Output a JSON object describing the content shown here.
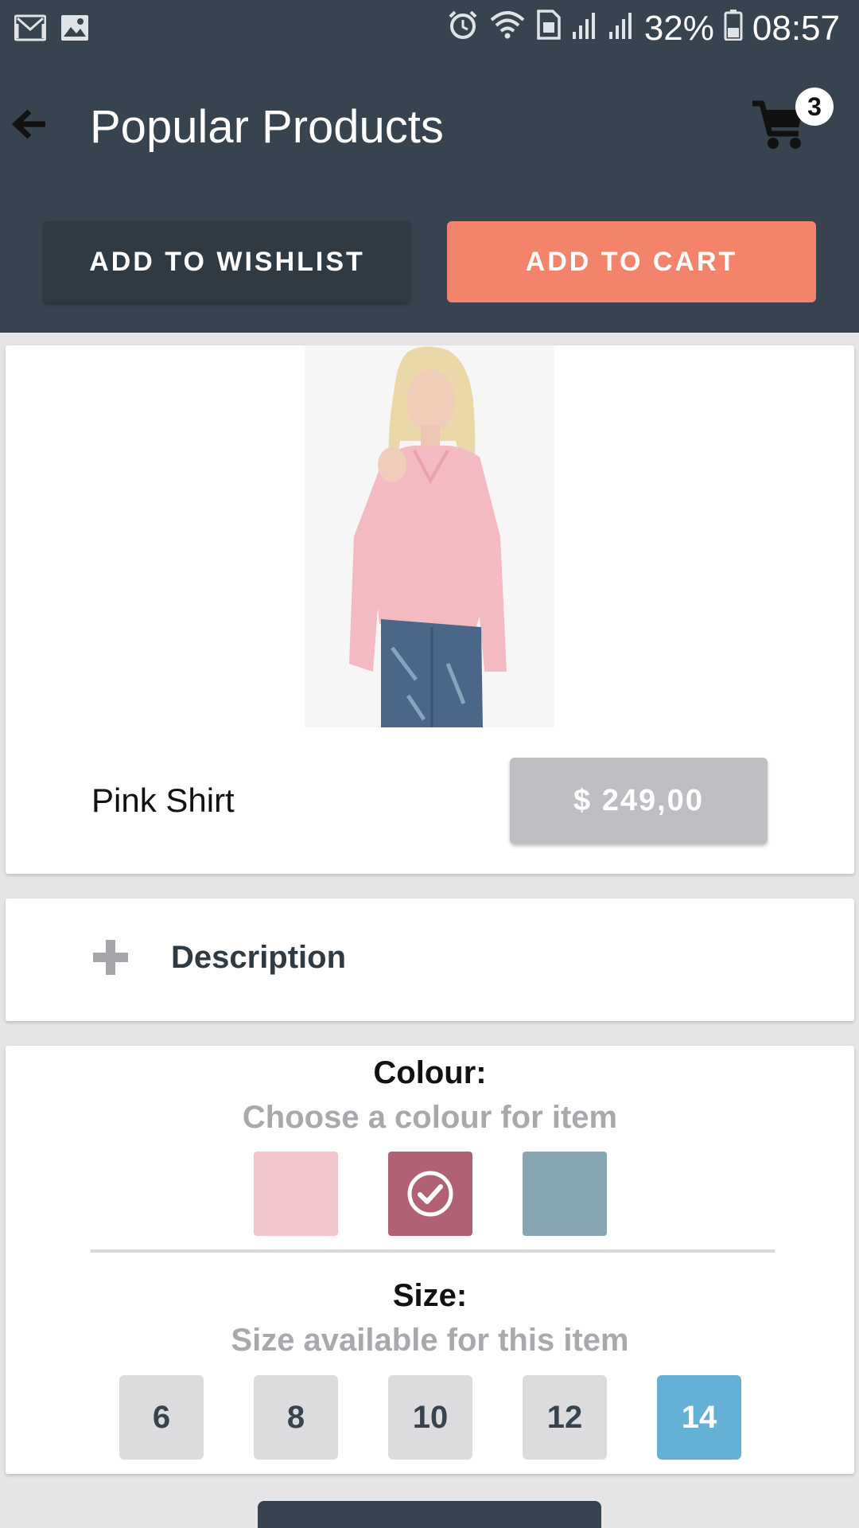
{
  "status_bar": {
    "battery": "32%",
    "time": "08:57",
    "left_icons": [
      "gmail-icon",
      "gallery-icon"
    ],
    "right_icons": [
      "alarm-icon",
      "wifi-icon",
      "sim-icon",
      "signal-icon",
      "signal-icon",
      "battery-icon"
    ]
  },
  "appbar": {
    "title": "Popular Products",
    "back_icon": "arrow-left-icon",
    "cart_icon": "cart-icon",
    "cart_count": "3"
  },
  "actions": {
    "wishlist_label": "ADD TO WISHLIST",
    "cart_label": "ADD TO CART"
  },
  "product": {
    "name": "Pink Shirt",
    "price": "$ 249,00"
  },
  "description": {
    "label": "Description",
    "icon": "plus-icon"
  },
  "colour": {
    "heading": "Colour:",
    "subtitle": "Choose a colour for item",
    "swatches": [
      {
        "color": "#f0c5cc",
        "selected": false
      },
      {
        "color": "#b06174",
        "selected": true
      },
      {
        "color": "#86a6b1",
        "selected": false
      }
    ]
  },
  "size": {
    "heading": "Size:",
    "subtitle": "Size available for this item",
    "options": [
      "6",
      "8",
      "10",
      "12",
      "14"
    ],
    "selected": "14"
  },
  "colors": {
    "header_bg": "#37444f",
    "accent": "#f4836b",
    "selected_size": "#63b2d6"
  }
}
